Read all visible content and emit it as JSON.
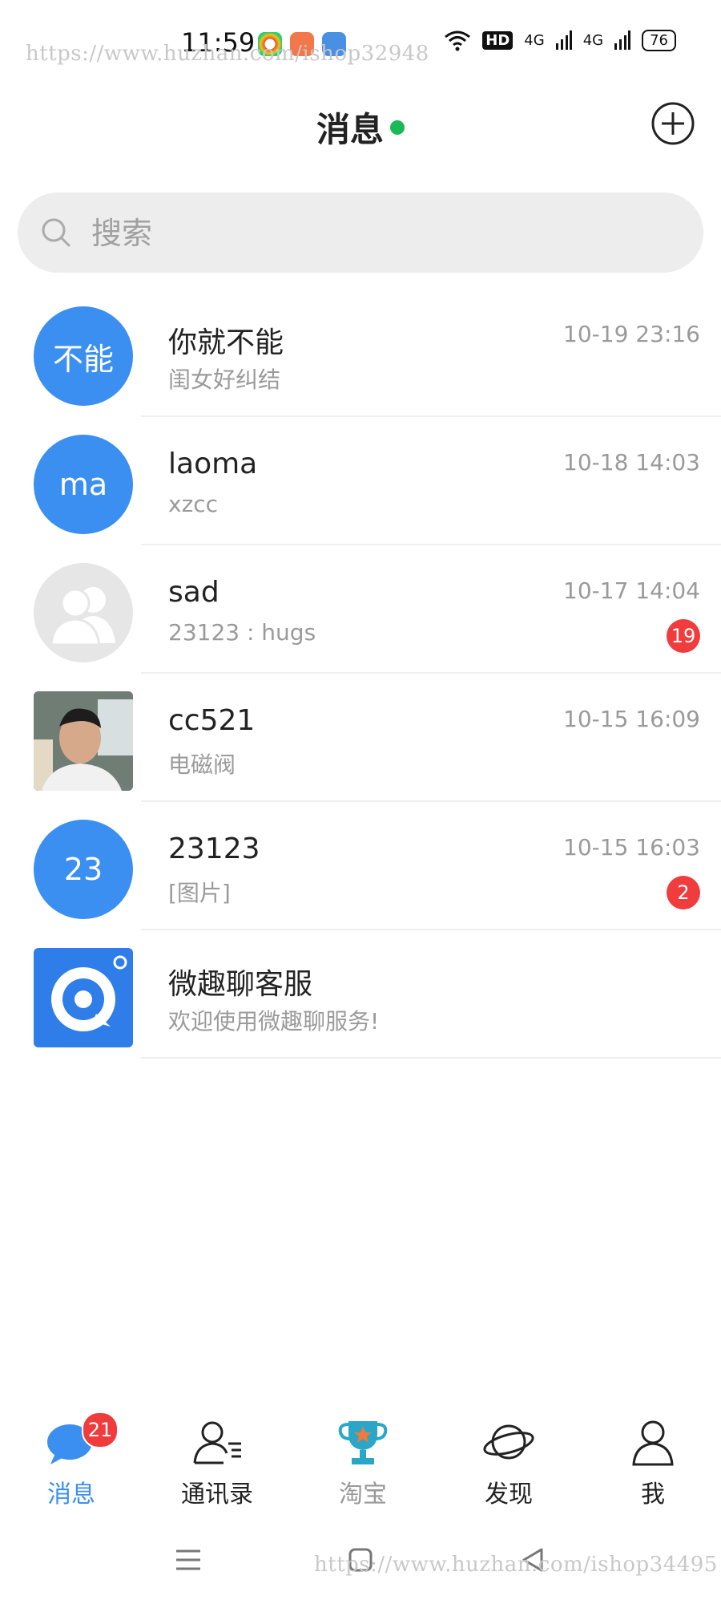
{
  "status_bar": {
    "time": "11:59",
    "network": "HD",
    "signal1": "4G",
    "signal2": "4G",
    "battery": "76"
  },
  "watermarks": {
    "top": "https://www.huzhan.com/ishop32948",
    "bottom": "https://www.huzhan.com/ishop34495"
  },
  "header": {
    "title": "消息",
    "online_color": "#19b955"
  },
  "search": {
    "placeholder": "搜索"
  },
  "conversations": [
    {
      "avatar_text": "不能",
      "avatar_kind": "text",
      "name": "你就不能",
      "preview": "闺女好纠结",
      "time": "10-19 23:16",
      "badge": ""
    },
    {
      "avatar_text": "ma",
      "avatar_kind": "text",
      "name": "laoma",
      "preview": "xzcc",
      "time": "10-18 14:03",
      "badge": ""
    },
    {
      "avatar_text": "",
      "avatar_kind": "group",
      "name": "sad",
      "preview": "23123 : hugs",
      "time": "10-17 14:04",
      "badge": "19"
    },
    {
      "avatar_text": "",
      "avatar_kind": "photo",
      "name": "cc521",
      "preview": "电磁阀",
      "time": "10-15 16:09",
      "badge": ""
    },
    {
      "avatar_text": "23",
      "avatar_kind": "text",
      "name": "23123",
      "preview": "[图片]",
      "time": "10-15 16:03",
      "badge": "2"
    },
    {
      "avatar_text": "",
      "avatar_kind": "service",
      "name": "微趣聊客服",
      "preview": "欢迎使用微趣聊服务!",
      "time": "",
      "badge": ""
    }
  ],
  "tabs": [
    {
      "label": "消息",
      "icon": "chat-bubble-icon",
      "badge": "21"
    },
    {
      "label": "通讯录",
      "icon": "contacts-icon",
      "badge": ""
    },
    {
      "label": "淘宝",
      "icon": "trophy-icon",
      "badge": ""
    },
    {
      "label": "发现",
      "icon": "planet-icon",
      "badge": ""
    },
    {
      "label": "我",
      "icon": "person-icon",
      "badge": ""
    }
  ],
  "colors": {
    "accent": "#3b8ff0",
    "badge": "#f03c3c"
  }
}
